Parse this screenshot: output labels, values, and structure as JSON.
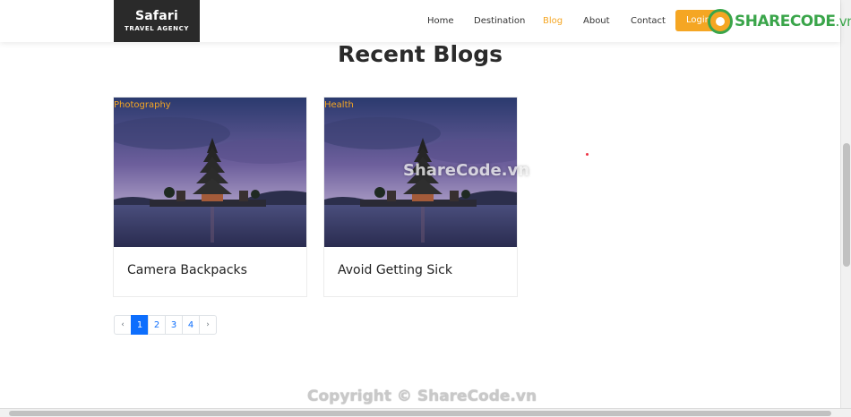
{
  "brand": {
    "name": "Safari",
    "subtitle": "TRAVEL AGENCY"
  },
  "nav": {
    "items": [
      {
        "label": "Home",
        "active": false
      },
      {
        "label": "Destination",
        "active": false
      },
      {
        "label": "Blog",
        "active": true
      },
      {
        "label": "About",
        "active": false
      },
      {
        "label": "Contact",
        "active": false
      }
    ],
    "login_label": "Login"
  },
  "watermark": {
    "logo_text": "SHARECODE",
    "logo_suffix": ".vn",
    "center": "ShareCode.vn",
    "copyright": "Copyright © ShareCode.vn"
  },
  "section": {
    "title": "Recent Blogs"
  },
  "cards": [
    {
      "tag": "Photography",
      "title": "Camera Backpacks",
      "image": "temple-lake-photo"
    },
    {
      "tag": "Health",
      "title": "Avoid Getting Sick",
      "image": "temple-lake-photo"
    }
  ],
  "pagination": {
    "prev": "‹",
    "pages": [
      "1",
      "2",
      "3",
      "4"
    ],
    "active_page": "1",
    "next": "›"
  },
  "colors": {
    "accent": "#f5a623",
    "brand_bg": "#2a2a2a",
    "page_link": "#0d6efd",
    "watermark_green": "#3aa54a"
  }
}
